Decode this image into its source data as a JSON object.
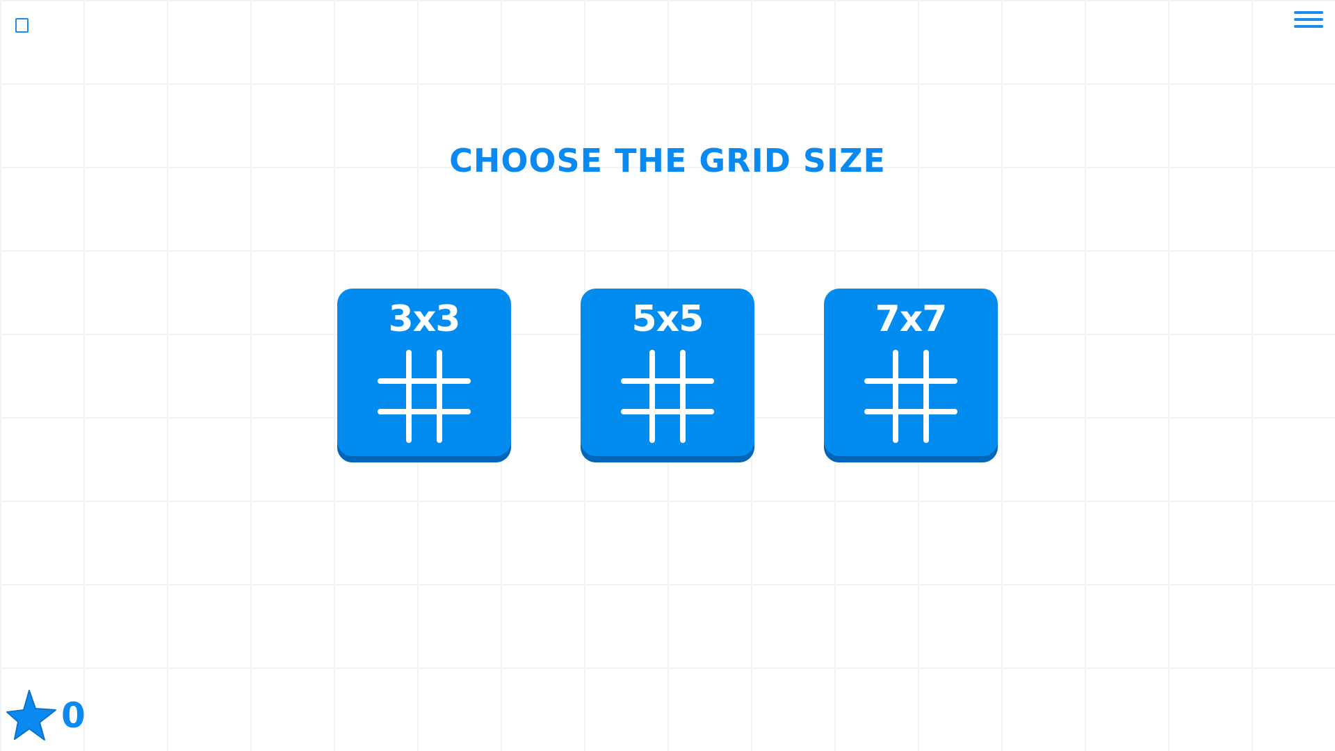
{
  "header": {
    "menu_icon": "hamburger-menu-icon",
    "corner_icon": "square-outline-icon"
  },
  "title": "CHOOSE THE GRID SIZE",
  "grid_options": [
    {
      "label": "3x3",
      "icon": "grid-hash-icon"
    },
    {
      "label": "5x5",
      "icon": "grid-hash-icon"
    },
    {
      "label": "7x7",
      "icon": "grid-hash-icon"
    }
  ],
  "score": {
    "icon": "star-icon",
    "value": "0"
  },
  "colors": {
    "accent": "#0a8af0",
    "button": "#038cf0",
    "button_shadow": "#0266b8",
    "grid_lines": "#eef3f8"
  }
}
